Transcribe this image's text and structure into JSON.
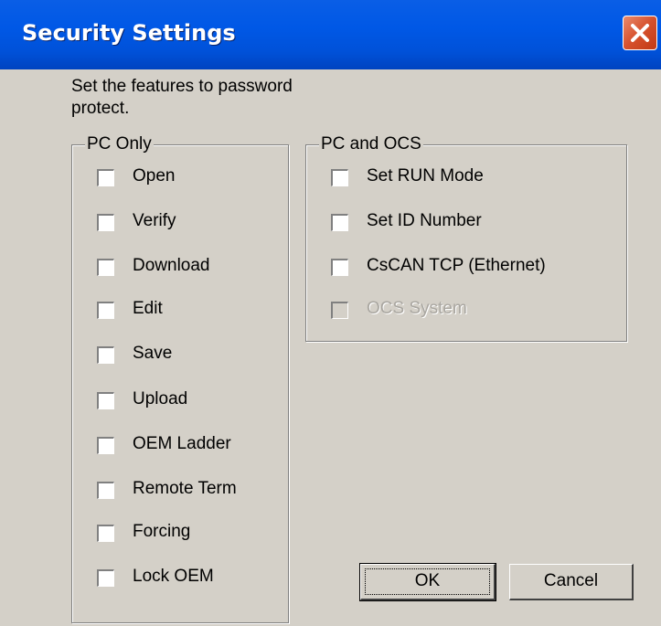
{
  "window": {
    "title": "Security Settings"
  },
  "instructions": "Set the features to password protect.",
  "pc_only": {
    "label": "PC Only",
    "items": [
      {
        "label": "Open",
        "checked": false,
        "enabled": true
      },
      {
        "label": "Verify",
        "checked": false,
        "enabled": true
      },
      {
        "label": "Download",
        "checked": false,
        "enabled": true
      },
      {
        "label": "Edit",
        "checked": false,
        "enabled": true
      },
      {
        "label": "Save",
        "checked": false,
        "enabled": true
      },
      {
        "label": "Upload",
        "checked": false,
        "enabled": true
      },
      {
        "label": "OEM Ladder",
        "checked": false,
        "enabled": true
      },
      {
        "label": "Remote Term",
        "checked": false,
        "enabled": true
      },
      {
        "label": "Forcing",
        "checked": false,
        "enabled": true
      },
      {
        "label": "Lock OEM",
        "checked": false,
        "enabled": true
      }
    ]
  },
  "pc_and_ocs": {
    "label": "PC and OCS",
    "items": [
      {
        "label": "Set RUN Mode",
        "checked": false,
        "enabled": true
      },
      {
        "label": "Set ID Number",
        "checked": false,
        "enabled": true
      },
      {
        "label": "CsCAN TCP (Ethernet)",
        "checked": false,
        "enabled": true
      },
      {
        "label": "OCS System",
        "checked": false,
        "enabled": false
      }
    ]
  },
  "buttons": {
    "ok": "OK",
    "cancel": "Cancel"
  },
  "colors": {
    "titlebar": "#0058e6",
    "face": "#d4d0c8",
    "close": "#d6502c"
  }
}
